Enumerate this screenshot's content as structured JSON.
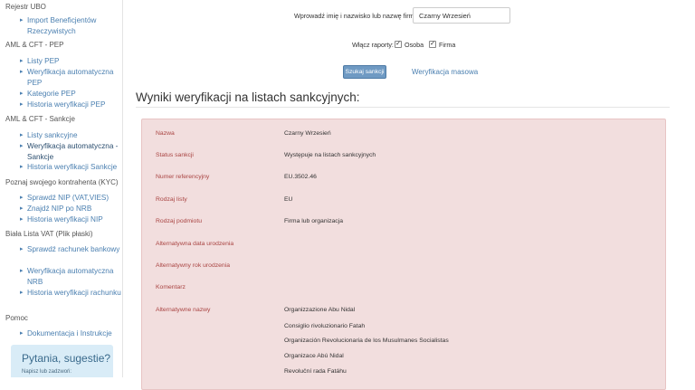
{
  "sidebar": {
    "sections": [
      {
        "label": "Rejestr UBO",
        "items": [
          "Import Beneficjentów Rzeczywistych"
        ]
      },
      {
        "label": "AML & CFT - PEP",
        "items": [
          "Listy PEP",
          "Weryfikacja automatyczna PEP",
          "Kategorie PEP",
          "Historia weryfikacji PEP"
        ]
      },
      {
        "label": "AML & CFT - Sankcje",
        "items": [
          "Listy sankcyjne",
          "Weryfikacja automatyczna - Sankcje",
          "Historia weryfikacji Sankcje"
        ]
      },
      {
        "label": "Poznaj swojego kontrahenta (KYC)",
        "items": [
          "Sprawdź NIP (VAT,VIES)",
          "Znajdź NIP po NRB",
          "Historia weryfikacji NIP"
        ]
      },
      {
        "label": "Biała Lista VAT (Plik płaski)",
        "items": [
          "Sprawdź rachunek bankowy",
          "Weryfikacja automatyczna NRB",
          "Historia weryfikacji rachunku"
        ]
      },
      {
        "label": "Pomoc",
        "items": [
          "Dokumentacja i Instrukcje"
        ]
      }
    ],
    "help": {
      "title": "Pytania, sugestie?",
      "subtitle": "Napisz lub zadzwoń:"
    }
  },
  "form": {
    "name_label": "Wprowadź imię i nazwisko lub nazwę firmy:",
    "name_value": "Czarny Wrzesień",
    "reports_label": "Włącz raporty:",
    "opt_person": "Osoba",
    "opt_company": "Firma",
    "search_button": "Szukaj sankcji",
    "mass_link": "Weryfikacja masowa"
  },
  "results": {
    "title": "Wyniki weryfikacji na listach sankcyjnych:",
    "fields": {
      "name_label": "Nazwa",
      "name_value": "Czarny Wrzesień",
      "status_label": "Status sankcji",
      "status_value": "Występuje na listach sankcyjnych",
      "ref_label": "Numer referencyjny",
      "ref_value": "EU.3502.46",
      "list_label": "Rodzaj listy",
      "list_value": "EU",
      "entity_label": "Rodzaj podmiotu",
      "entity_value": "Firma lub organizacja",
      "altdate_label": "Alternatywna data urodzenia",
      "altyear_label": "Alternatywny rok urodzenia",
      "comment_label": "Komentarz",
      "altnames_label": "Alternatywne nazwy"
    },
    "alt_names": [
      "Organizzazione Abu Nidal",
      "Consiglio rivoluzionario Fatah",
      "Organización Revolucionaria de los Musulmanes Socialistas",
      "Organizace Abú Nidal",
      "Revoluční rada Fatáhu"
    ]
  }
}
